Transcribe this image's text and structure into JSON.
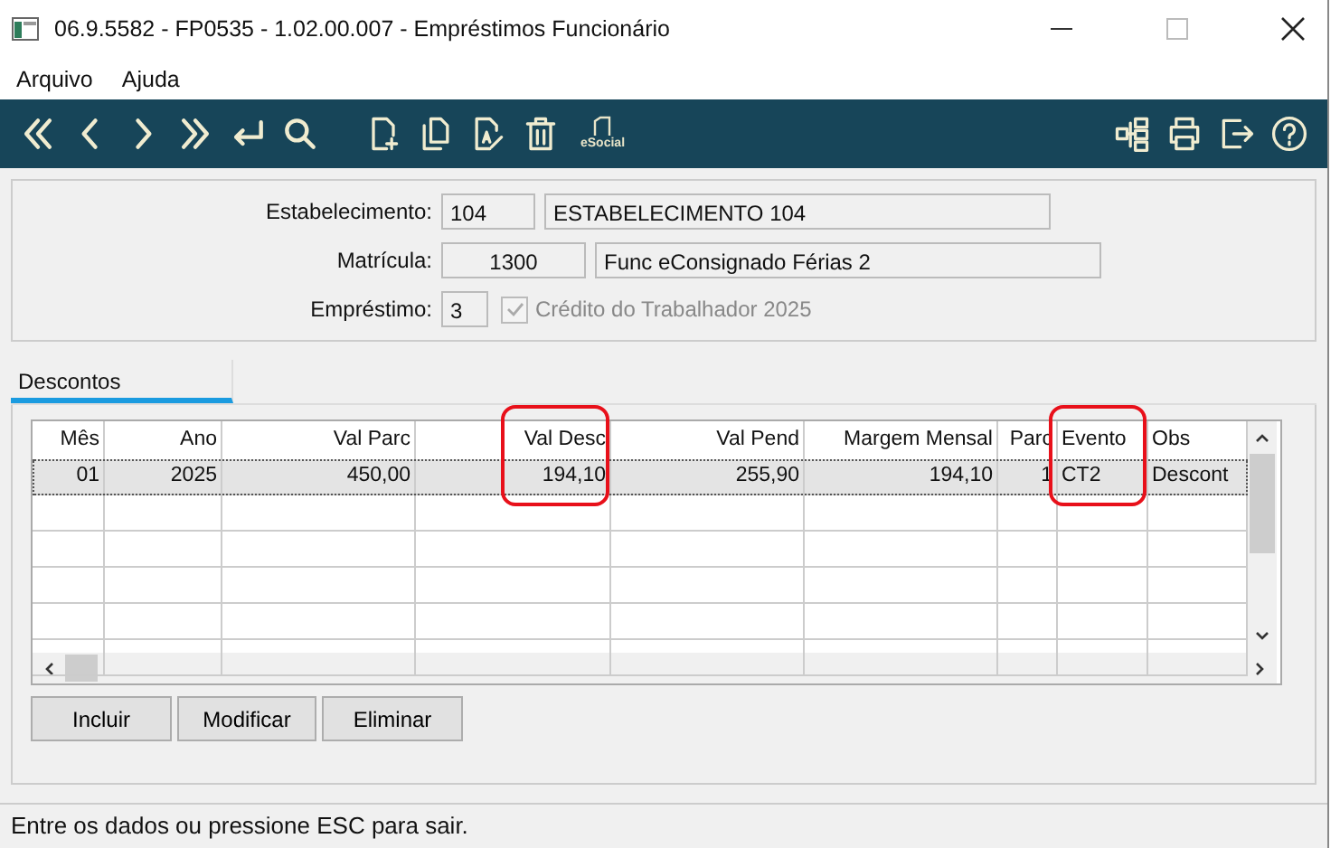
{
  "window": {
    "title": "06.9.5582 - FP0535 - 1.02.00.007 - Empréstimos Funcionário"
  },
  "menu": [
    "Arquivo",
    "Ajuda"
  ],
  "toolbar": {
    "esocial_label": "eSocial"
  },
  "form": {
    "estabelecimento": {
      "label": "Estabelecimento:",
      "code": "104",
      "name": "ESTABELECIMENTO 104"
    },
    "matricula": {
      "label": "Matrícula:",
      "code": "1300",
      "name": "Func eConsignado Férias 2"
    },
    "emprestimo": {
      "label": "Empréstimo:",
      "code": "3",
      "checkbox_label": "Crédito do Trabalhador 2025",
      "checked": true,
      "disabled": true
    }
  },
  "tabs": [
    {
      "label": "Descontos",
      "selected": true
    }
  ],
  "table": {
    "columns": [
      {
        "label": "Mês",
        "highlighted": false
      },
      {
        "label": "Ano",
        "highlighted": false
      },
      {
        "label": "Val Parc",
        "highlighted": false
      },
      {
        "label": "Val Desc",
        "highlighted": true
      },
      {
        "label": "Val Pend",
        "highlighted": false
      },
      {
        "label": "Margem Mensal",
        "highlighted": false
      },
      {
        "label": "Parc",
        "highlighted": false
      },
      {
        "label": "Evento",
        "highlighted": true
      },
      {
        "label": "Obs",
        "highlighted": false
      }
    ],
    "rows": [
      {
        "selected": true,
        "cells": [
          "01",
          "2025",
          "450,00",
          "194,10",
          "255,90",
          "194,10",
          "1",
          "CT2",
          "Descont"
        ]
      }
    ]
  },
  "buttons": [
    "Incluir",
    "Modificar",
    "Eliminar"
  ],
  "status_bar": "Entre os dados ou pressione ESC para sair."
}
